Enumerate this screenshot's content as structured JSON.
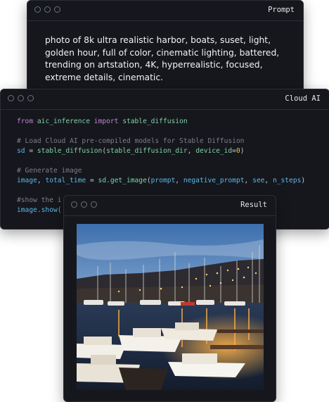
{
  "prompt_window": {
    "title": "Prompt",
    "text": "photo of 8k ultra realistic harbor, boats, suset, light, golden hour, full of color, cinematic lighting, battered, trending on artstation, 4K, hyperrealistic, focused, extreme details, cinematic."
  },
  "code_window": {
    "title": "Cloud AI",
    "code": {
      "kw_from": "from",
      "module": "aic_inference",
      "kw_import": "import",
      "imported": "stable_diffusion",
      "comment_load": "# Load Cloud AI pre-compiled models for Stable Diffusion",
      "sd": "sd",
      "eq": " = ",
      "sd_fn": "stable_diffusion",
      "sd_args_a": "stable_diffusion_dir",
      "sep": ", ",
      "device_arg": "device_id",
      "device_eq": "=",
      "device_val": "0",
      "comment_generate": "# Generate image",
      "image": "image",
      "total_time": "total_time",
      "get_image": "sd.get_image",
      "arg_prompt": "prompt",
      "arg_neg": "negative_prompt",
      "arg_see": "see",
      "arg_steps": "n_steps",
      "comment_show": "#show the i",
      "show_call": "image.show("
    }
  },
  "result_window": {
    "title": "Result"
  },
  "colors": {
    "window_bg": "#15171c",
    "keyword": "#c183d8",
    "module": "#7fd0a8",
    "comment": "#7b7f88",
    "identifier": "#5ab6e8",
    "number": "#d9c26e"
  }
}
